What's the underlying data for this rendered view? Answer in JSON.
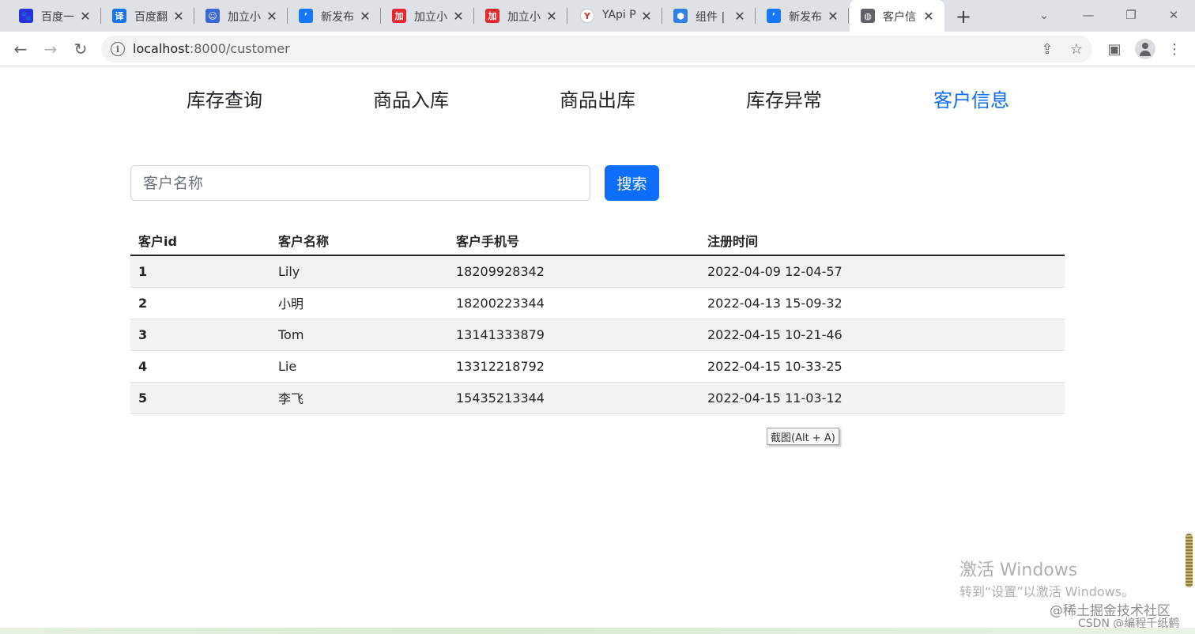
{
  "browser": {
    "tabs": [
      {
        "title": "百度一",
        "icon": "baidu-paw-icon",
        "color": "#2932e1",
        "glyph": "🐾"
      },
      {
        "title": "百度翻",
        "icon": "baidu-translate-icon",
        "color": "#1a73e8",
        "glyph": "译"
      },
      {
        "title": "加立小",
        "icon": "mascot-icon",
        "color": "#3a66d6",
        "glyph": "☺"
      },
      {
        "title": "新发布",
        "icon": "doc-app-icon",
        "color": "#1677ff",
        "glyph": "ʼ"
      },
      {
        "title": "加立小",
        "icon": "jiali-red-icon",
        "color": "#e8262e",
        "glyph": "加"
      },
      {
        "title": "加立小",
        "icon": "jiali-red-icon",
        "color": "#e8262e",
        "glyph": "加"
      },
      {
        "title": "YApi P",
        "icon": "yapi-icon",
        "color": "#ffffff",
        "glyph": "Y"
      },
      {
        "title": "组件 |",
        "icon": "component-hex-icon",
        "color": "#2f80ed",
        "glyph": "⬢"
      },
      {
        "title": "新发布",
        "icon": "doc-app-icon",
        "color": "#1677ff",
        "glyph": "ʼ"
      },
      {
        "title": "客户信",
        "icon": "globe-icon",
        "color": "#5f6368",
        "glyph": "◍"
      }
    ],
    "url_host": "localhost",
    "url_path": ":8000/customer"
  },
  "nav": {
    "items": [
      "库存查询",
      "商品入库",
      "商品出库",
      "库存异常",
      "客户信息"
    ],
    "active_index": 4,
    "active_color": "#0d6efd"
  },
  "search": {
    "placeholder": "客户名称",
    "button_label": "搜索"
  },
  "table": {
    "headers": [
      "客户id",
      "客户名称",
      "客户手机号",
      "注册时间"
    ],
    "rows": [
      [
        "1",
        "Lily",
        "18209928342",
        "2022-04-09 12-04-57"
      ],
      [
        "2",
        "小明",
        "18200223344",
        "2022-04-13 15-09-32"
      ],
      [
        "3",
        "Tom",
        "13141333879",
        "2022-04-15 10-21-46"
      ],
      [
        "4",
        "Lie",
        "13312218792",
        "2022-04-15 10-33-25"
      ],
      [
        "5",
        "李飞",
        "15435213344",
        "2022-04-15 11-03-12"
      ]
    ]
  },
  "tooltip": "截图(Alt + A)",
  "watermark": {
    "line1": "激活 Windows",
    "line2": "转到“设置”以激活 Windows。",
    "line3": "@稀土掘金技术社区",
    "line4": "CSDN @编程千纸鹤"
  }
}
